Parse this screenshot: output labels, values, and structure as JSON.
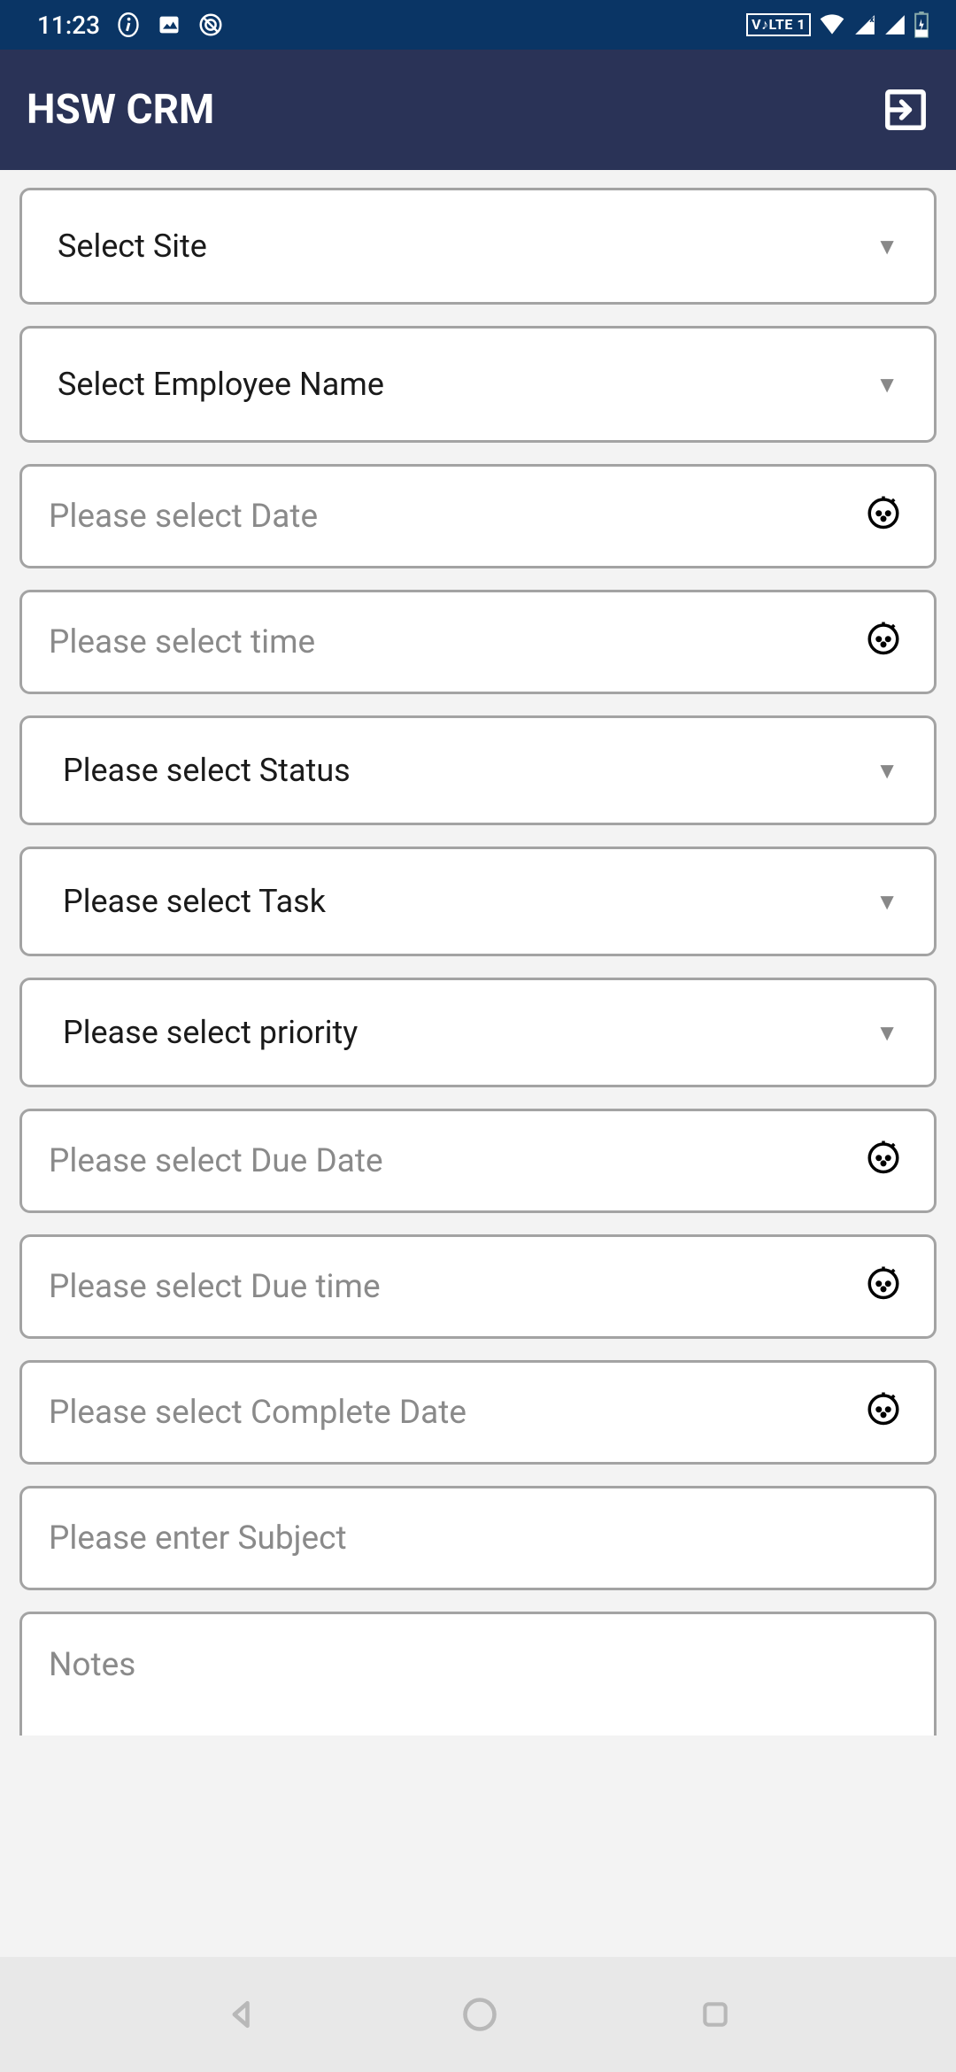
{
  "status_bar": {
    "time": "11:23",
    "volte_label": "V♪LTE 1"
  },
  "app_bar": {
    "title": "HSW CRM"
  },
  "form": {
    "site": {
      "label": "Select Site"
    },
    "employee": {
      "label": "Select Employee Name"
    },
    "date": {
      "placeholder": "Please select Date"
    },
    "time": {
      "placeholder": "Please select time"
    },
    "status": {
      "label": "Please select Status"
    },
    "task": {
      "label": "Please select Task"
    },
    "priority": {
      "label": "Please select priority"
    },
    "due_date": {
      "placeholder": "Please select Due Date"
    },
    "due_time": {
      "placeholder": "Please select Due time"
    },
    "complete_date": {
      "placeholder": "Please select Complete Date"
    },
    "subject": {
      "placeholder": "Please enter Subject"
    },
    "notes": {
      "placeholder": "Notes"
    }
  }
}
